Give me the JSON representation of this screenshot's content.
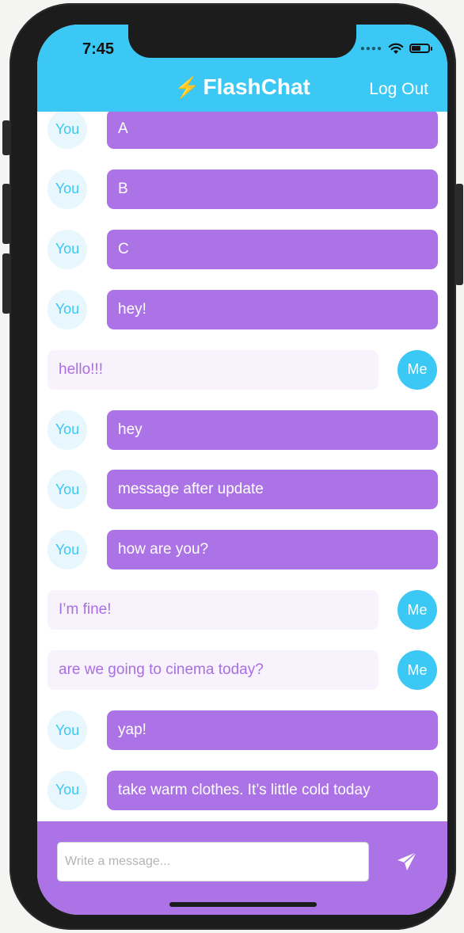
{
  "status_bar": {
    "time": "7:45",
    "signal_icon": "signal-dots-icon",
    "wifi_icon": "wifi-icon",
    "battery_icon": "battery-icon",
    "battery_level": 0.6
  },
  "header": {
    "bolt_icon": "lightning-bolt-icon",
    "bolt_glyph": "⚡",
    "title": "FlashChat",
    "logout_label": "Log Out",
    "background": "#3cc8f4"
  },
  "messages": [
    {
      "sender": "You",
      "text": "A",
      "mine": false
    },
    {
      "sender": "You",
      "text": "B",
      "mine": false
    },
    {
      "sender": "You",
      "text": "C",
      "mine": false
    },
    {
      "sender": "You",
      "text": "hey!",
      "mine": false
    },
    {
      "sender": "Me",
      "text": "hello!!!",
      "mine": true
    },
    {
      "sender": "You",
      "text": "hey",
      "mine": false
    },
    {
      "sender": "You",
      "text": "message after update",
      "mine": false
    },
    {
      "sender": "You",
      "text": "how are you?",
      "mine": false
    },
    {
      "sender": "Me",
      "text": "I’m fine!",
      "mine": true
    },
    {
      "sender": "Me",
      "text": "are we going to cinema today?",
      "mine": true
    },
    {
      "sender": "You",
      "text": "yap!",
      "mine": false
    },
    {
      "sender": "You",
      "text": "take warm clothes. It’s little cold today",
      "mine": false
    }
  ],
  "composer": {
    "placeholder": "Write a message...",
    "value": "",
    "send_icon": "paper-plane-icon",
    "background": "#ab73e6"
  },
  "colors": {
    "accent_blue": "#3cc8f4",
    "accent_purple": "#ab73e6",
    "mine_bubble": "#f7f2fc",
    "mine_text": "#a96fe0"
  }
}
